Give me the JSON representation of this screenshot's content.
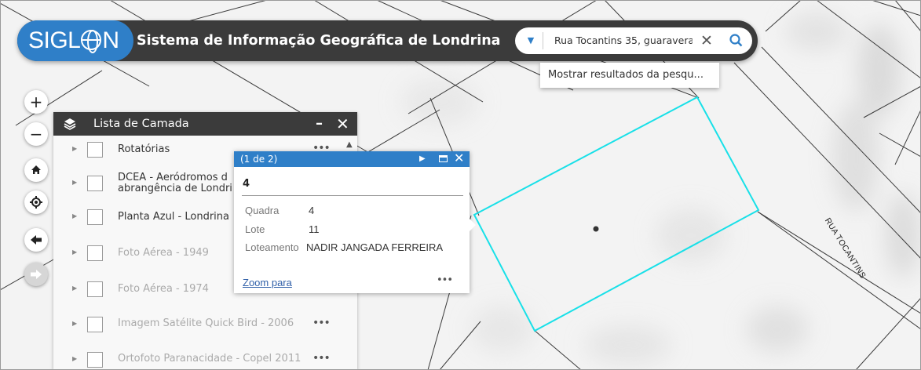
{
  "header": {
    "logo_prefix": "SIGL",
    "logo_suffix": "N",
    "title": "Sistema de Informação Geográfica de Londrina"
  },
  "search": {
    "value": "Rua Tocantins 35, guaravera",
    "suggestion": "Mostrar resultados da pesqu..."
  },
  "nav": {
    "zoom_in": "+",
    "zoom_out": "−"
  },
  "layer_list": {
    "title": "Lista de Camada",
    "items": [
      {
        "label": "Rotatórias",
        "label2": "",
        "enabled": true,
        "more": "•••"
      },
      {
        "label": "DCEA - Aeródromos d",
        "label2": "abrangência de Londri",
        "enabled": true,
        "more": ""
      },
      {
        "label": "Planta Azul - Londrina",
        "label2": "",
        "enabled": true,
        "more": ""
      },
      {
        "label": "Foto Aérea - 1949",
        "label2": "",
        "enabled": false,
        "more": ""
      },
      {
        "label": "Foto Aérea - 1974",
        "label2": "",
        "enabled": false,
        "more": ""
      },
      {
        "label": "Imagem Satélite Quick Bird - 2006",
        "label2": "",
        "enabled": false,
        "more": "•••"
      },
      {
        "label": "Ortofoto Paranacidade - Copel 2011",
        "label2": "",
        "enabled": false,
        "more": "•••"
      }
    ]
  },
  "popup": {
    "counter": "(1 de 2)",
    "title": "4",
    "fields": [
      {
        "key": "Quadra",
        "value": "4"
      },
      {
        "key": "Lote",
        "value": "11"
      },
      {
        "key": "Loteamento",
        "value": "NADIR JANGADA FERREIRA"
      }
    ],
    "zoom_label": "Zoom para",
    "more": "•••"
  },
  "map": {
    "street_label": "RUA TOCANTINS",
    "highlight_color": "#18e0e8"
  }
}
